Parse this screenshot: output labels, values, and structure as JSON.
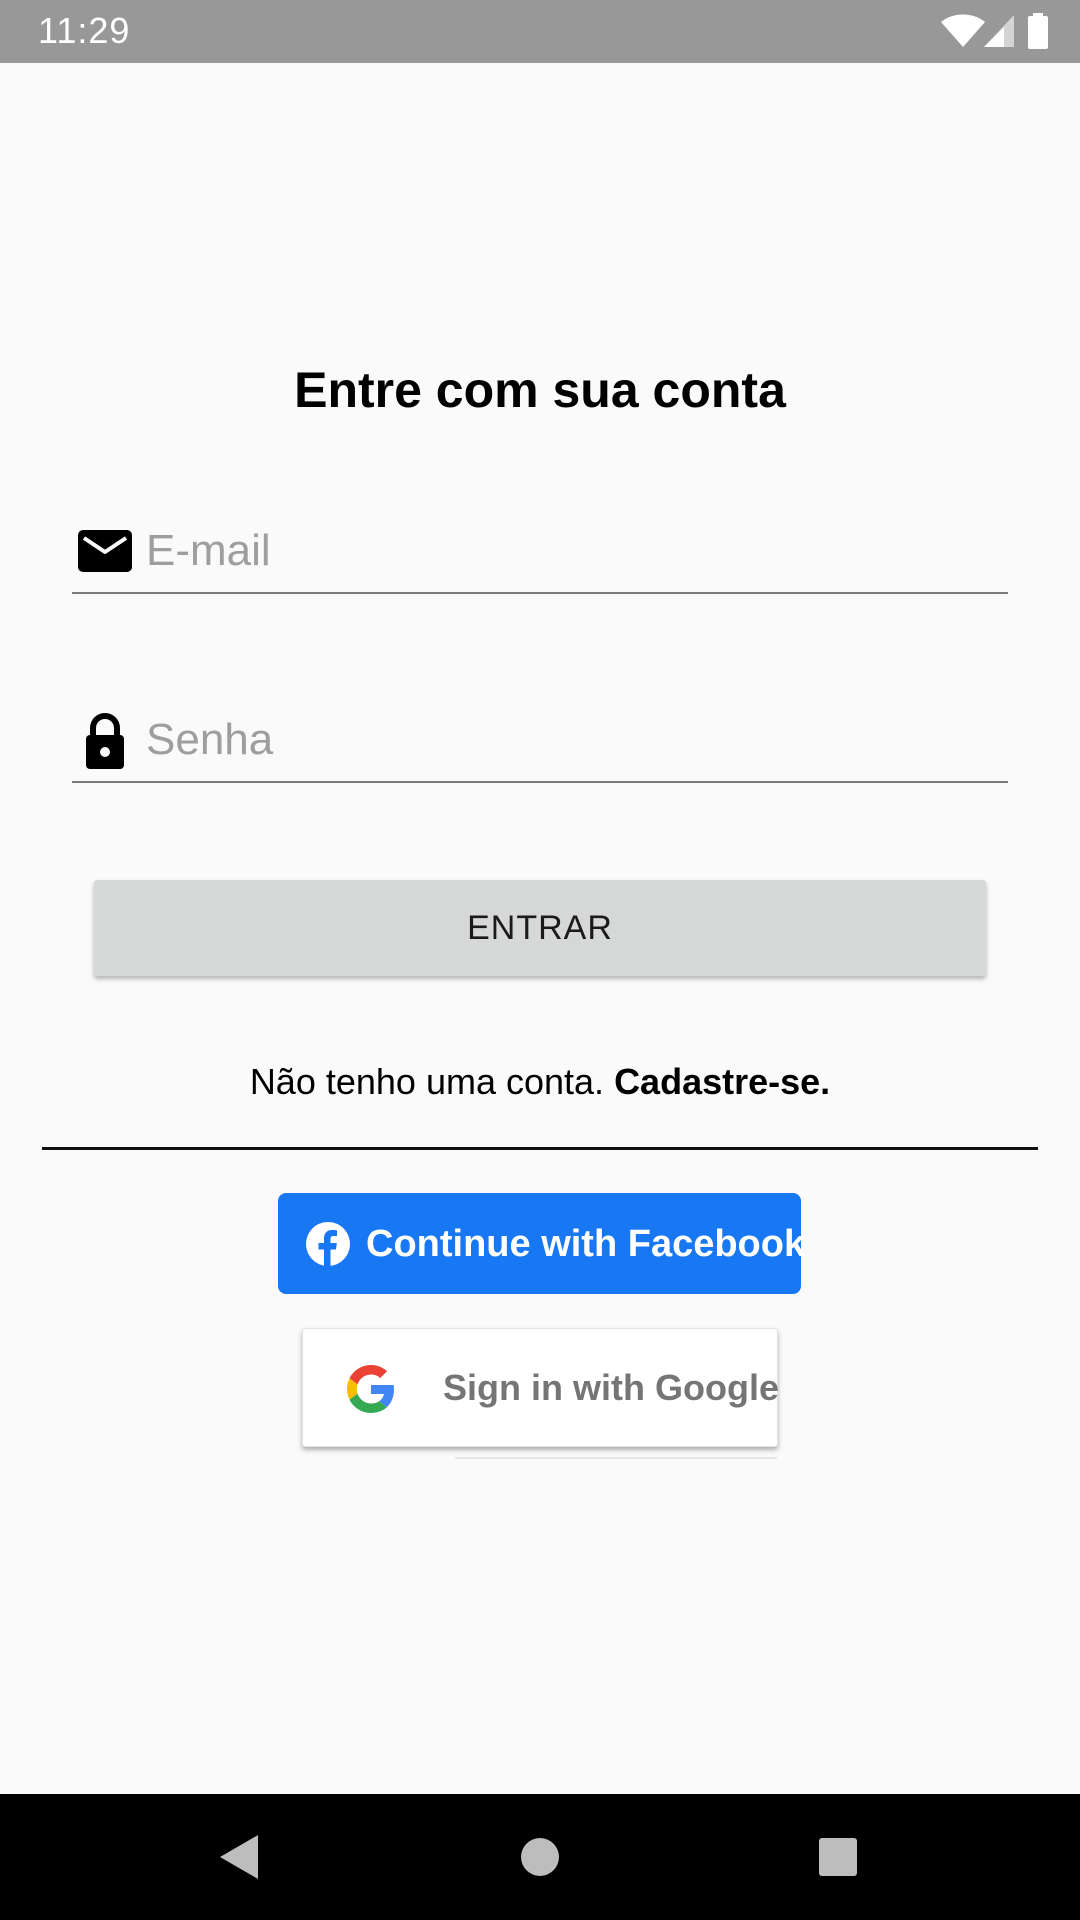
{
  "status_bar": {
    "time": "11:29",
    "icons": [
      "wifi-icon",
      "cellular-signal-icon",
      "battery-icon"
    ]
  },
  "login": {
    "title": "Entre com sua conta",
    "email_placeholder": "E-mail",
    "email_value": "",
    "email_icon": "mail-icon",
    "password_placeholder": "Senha",
    "password_value": "",
    "password_icon": "lock-icon",
    "submit_label": "ENTRAR",
    "signup_prompt": "Não tenho uma conta.",
    "signup_link": "Cadastre-se."
  },
  "social": {
    "facebook_label": "Continue with Facebook",
    "facebook_color": "#1877F2",
    "google_label": "Sign in with Google"
  },
  "nav_bar": {
    "buttons": [
      "back-icon",
      "home-icon",
      "recents-icon"
    ]
  }
}
